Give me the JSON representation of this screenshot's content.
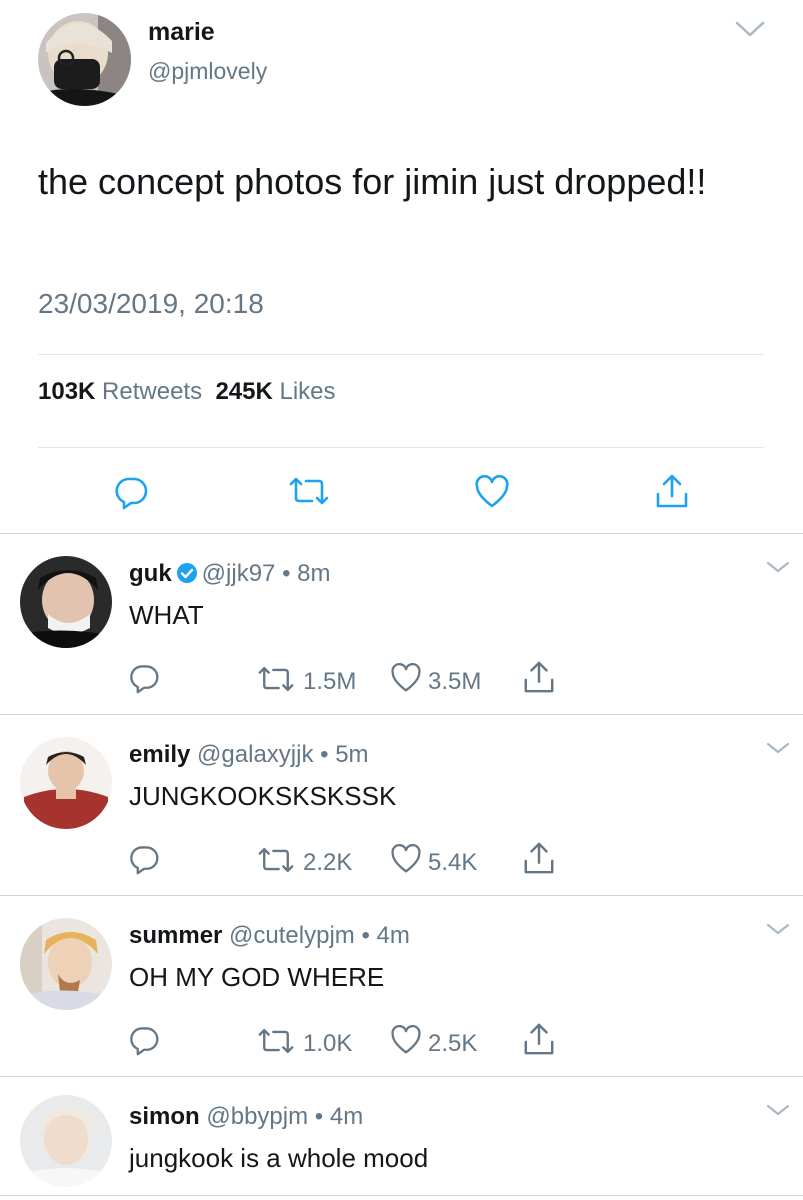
{
  "main_tweet": {
    "name": "marie",
    "handle": "@pjmlovely",
    "text": "the concept photos for jimin just dropped!!",
    "timestamp": "23/03/2019, 20:18",
    "retweets_count": "103K",
    "retweets_label": "Retweets",
    "likes_count": "245K",
    "likes_label": "Likes"
  },
  "replies": [
    {
      "name": "guk",
      "verified": true,
      "handle": "@jjk97",
      "separator": "•",
      "time": "8m",
      "text": "WHAT",
      "retweets": "1.5M",
      "likes": "3.5M"
    },
    {
      "name": "emily",
      "verified": false,
      "handle": "@galaxyjjk",
      "separator": "•",
      "time": "5m",
      "text": "JUNGKOOKSKSKSSK",
      "retweets": "2.2K",
      "likes": "5.4K"
    },
    {
      "name": "summer",
      "verified": false,
      "handle": "@cutelypjm",
      "separator": "•",
      "time": "4m",
      "text": "OH MY GOD WHERE",
      "retweets": "1.0K",
      "likes": "2.5K"
    },
    {
      "name": "simon",
      "verified": false,
      "handle": "@bbypjm",
      "separator": "•",
      "time": "4m",
      "text": "jungkook is a whole mood"
    }
  ],
  "colors": {
    "text": "#14171a",
    "secondary": "#657786",
    "icon": "#1da1f2",
    "divider": "#e1e8ed",
    "verified": "#1da1f2"
  },
  "icons": [
    "chevron-down-icon",
    "reply-icon",
    "retweet-icon",
    "heart-icon",
    "share-icon",
    "verified-badge-icon"
  ]
}
